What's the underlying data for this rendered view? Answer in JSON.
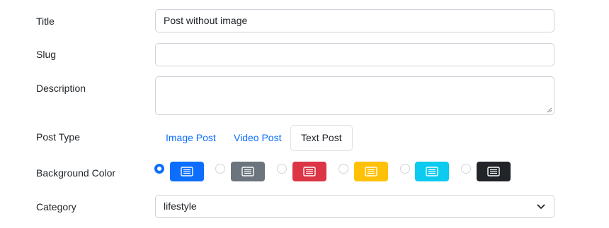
{
  "form": {
    "title": {
      "label": "Title",
      "value": "Post without image"
    },
    "slug": {
      "label": "Slug",
      "value": ""
    },
    "description": {
      "label": "Description",
      "value": ""
    },
    "post_type": {
      "label": "Post Type",
      "tabs": [
        {
          "label": "Image Post",
          "active": false
        },
        {
          "label": "Video Post",
          "active": false
        },
        {
          "label": "Text Post",
          "active": true
        }
      ]
    },
    "background_color": {
      "label": "Background Color",
      "options": [
        {
          "color": "#0d6efd",
          "icon": "list-icon",
          "checked": true
        },
        {
          "color": "#6c757d",
          "icon": "list-icon",
          "checked": false
        },
        {
          "color": "#dc3545",
          "icon": "list-icon",
          "checked": false
        },
        {
          "color": "#ffc107",
          "icon": "list-icon",
          "checked": false
        },
        {
          "color": "#0dcaf0",
          "icon": "list-icon",
          "checked": false
        },
        {
          "color": "#212529",
          "icon": "list-icon",
          "checked": false
        }
      ]
    },
    "category": {
      "label": "Category",
      "value": "lifestyle"
    }
  }
}
